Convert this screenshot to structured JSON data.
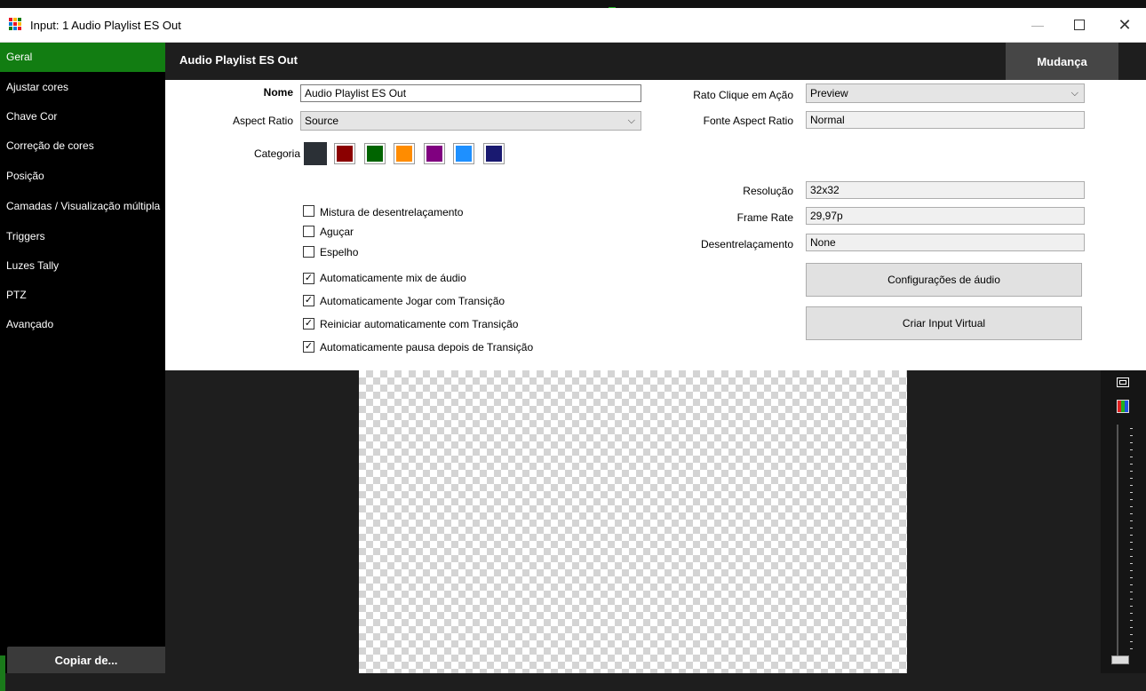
{
  "window": {
    "title": "Input: 1 Audio Playlist ES Out",
    "icon": "vmix-grid-icon",
    "controls": {
      "minimize": "—",
      "maximize": "☐",
      "close": "✕"
    }
  },
  "sidebar": {
    "items": [
      {
        "label": "Geral",
        "active": true
      },
      {
        "label": "Ajustar cores"
      },
      {
        "label": "Chave Cor"
      },
      {
        "label": "Correção de cores"
      },
      {
        "label": "Posição"
      },
      {
        "label": "Camadas / Visualização múltipla"
      },
      {
        "label": "Triggers"
      },
      {
        "label": "Luzes Tally"
      },
      {
        "label": "PTZ"
      },
      {
        "label": "Avançado"
      }
    ],
    "copy_button": "Copiar de..."
  },
  "header": {
    "title": "Audio Playlist ES Out",
    "change_button": "Mudança"
  },
  "form": {
    "name_label": "Nome",
    "name_value": "Audio Playlist ES Out",
    "aspect_label": "Aspect Ratio",
    "aspect_value": "Source",
    "category_label": "Categoria",
    "category_colors": [
      "#2b3036",
      "#8b0000",
      "#006400",
      "#ff8c00",
      "#800080",
      "#1e90ff",
      "#191970"
    ],
    "click_action_label": "Rato Clique em Ação",
    "click_action_value": "Preview",
    "source_aspect_label": "Fonte Aspect Ratio",
    "source_aspect_value": "Normal",
    "resolution_label": "Resolução",
    "resolution_value": "32x32",
    "framerate_label": "Frame Rate",
    "framerate_value": "29,97p",
    "deinterlace_label": "Desentrelaçamento",
    "deinterlace_value": "None",
    "audio_settings_button": "Configurações de áudio",
    "virtual_input_button": "Criar Input Virtual",
    "checkboxes": [
      {
        "label": "Mistura de desentrelaçamento",
        "checked": false
      },
      {
        "label": "Aguçar",
        "checked": false
      },
      {
        "label": "Espelho",
        "checked": false
      },
      {
        "label": "Automaticamente mix de áudio",
        "checked": true
      },
      {
        "label": "Automaticamente Jogar com Transição",
        "checked": true
      },
      {
        "label": "Reiniciar automaticamente com Transição",
        "checked": true
      },
      {
        "label": "Automaticamente pausa depois de Transição",
        "checked": true
      }
    ]
  }
}
